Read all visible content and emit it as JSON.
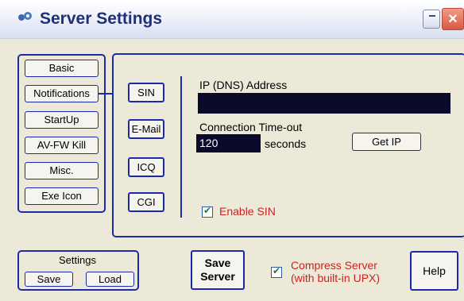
{
  "window": {
    "title": "Server Settings"
  },
  "left_nav": {
    "items": [
      {
        "label": "Basic"
      },
      {
        "label": "Notifications"
      },
      {
        "label": "StartUp"
      },
      {
        "label": "AV-FW Kill"
      },
      {
        "label": "Misc."
      },
      {
        "label": "Exe Icon"
      }
    ]
  },
  "notify_tabs": {
    "items": [
      {
        "label": "SIN"
      },
      {
        "label": "E-Mail"
      },
      {
        "label": "ICQ"
      },
      {
        "label": "CGI"
      }
    ]
  },
  "sin": {
    "ip_label": "IP (DNS) Address",
    "ip_value": "",
    "timeout_label": "Connection Time-out",
    "timeout_value": "120",
    "timeout_unit": "seconds",
    "get_ip_label": "Get IP",
    "enable_label": "Enable SIN"
  },
  "settings_group": {
    "title": "Settings",
    "save_label": "Save",
    "load_label": "Load"
  },
  "bottom": {
    "save_server_line1": "Save",
    "save_server_line2": "Server",
    "compress_line1": "Compress Server",
    "compress_line2": "(with built-in UPX)",
    "help_label": "Help"
  },
  "colors": {
    "accent": "#1d2aa8",
    "title_text": "#1f2f7a",
    "field_bg": "#0a0a2a",
    "warning_text": "#cc2222"
  }
}
